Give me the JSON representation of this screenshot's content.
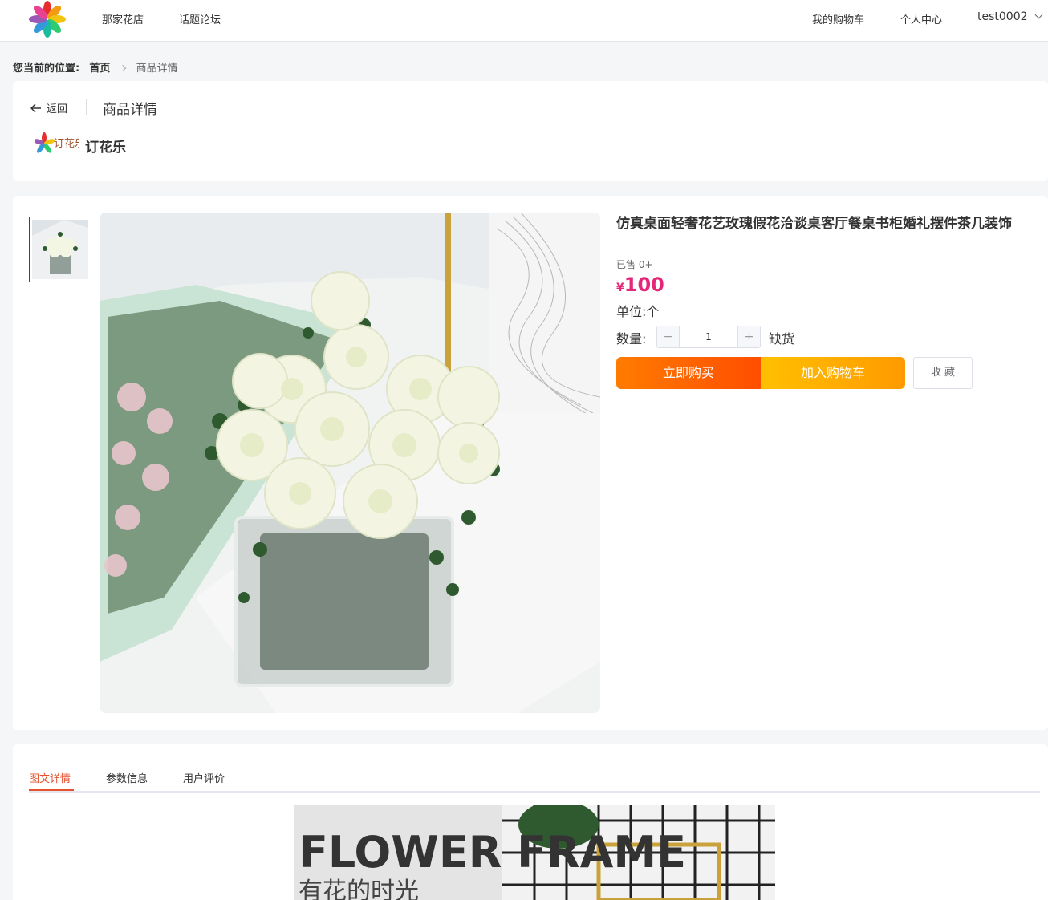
{
  "header": {
    "nav": [
      "那家花店",
      "话题论坛"
    ],
    "cart_label": "我的购物车",
    "profile_label": "个人中心",
    "username": "test0002"
  },
  "breadcrumb": {
    "prefix": "您当前的位置:",
    "home": "首页",
    "current": "商品详情"
  },
  "page": {
    "back_label": "返回",
    "title": "商品详情",
    "shop_name": "订花乐",
    "shop_logo_text": "订花乐"
  },
  "product": {
    "title": "仿真桌面轻奢花艺玫瑰假花洽谈桌客厅餐桌书柜婚礼摆件茶几装饰",
    "sold": "已售 0+",
    "currency": "¥",
    "price": "100",
    "unit": "单位:个",
    "quantity_label": "数量:",
    "quantity": "1",
    "stock_status": "缺货",
    "buy_label": "立即购买",
    "cart_label": "加入购物车",
    "favorite_label": "收 藏"
  },
  "tabs": {
    "items": [
      "图文详情",
      "参数信息",
      "用户评价"
    ],
    "active": "图文详情"
  },
  "detail": {
    "banner_title": "FLOWER FRAME",
    "banner_subtitle": "有花的时光"
  },
  "colors": {
    "price": "#e5277a",
    "active_tab": "#e6502c",
    "buy_button": "#ff6a00",
    "cart_button": "#ffae00",
    "thumb_border": "#d9001b"
  },
  "icons": {
    "logo": "pinwheel-logo-icon",
    "back": "arrow-left-icon",
    "dropdown": "chevron-down-icon",
    "breadcrumb_sep": "chevron-right-icon",
    "minus": "minus-icon",
    "plus": "plus-icon"
  }
}
